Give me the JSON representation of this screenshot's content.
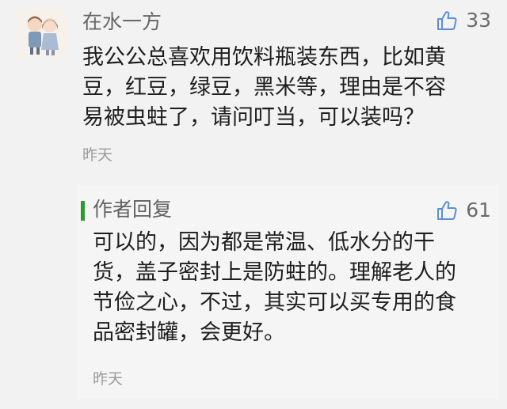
{
  "comment": {
    "author": "在水一方",
    "likes": "33",
    "lines": [
      "我公公总喜欢用饮料瓶装东西，比如黄",
      "豆，红豆，绿豆，黑米等，理由是不容",
      "易被虫蛀了，请问叮当，可以装吗？"
    ],
    "time": "昨天"
  },
  "reply": {
    "author": "作者回复",
    "likes": "61",
    "lines": [
      "可以的，因为都是常温、低水分的干",
      "货，盖子密封上是防蛀的。理解老人的",
      "节俭之心，不过，其实可以买专用的食",
      "品密封罐，会更好。"
    ],
    "time": "昨天"
  },
  "icons": {
    "like": "thumbs-up-icon",
    "avatar": "avatar-illustration"
  },
  "colors": {
    "author_reply_bar": "#2f9a2a",
    "background": "#f2f2f2",
    "reply_background": "#f5f5f5"
  }
}
